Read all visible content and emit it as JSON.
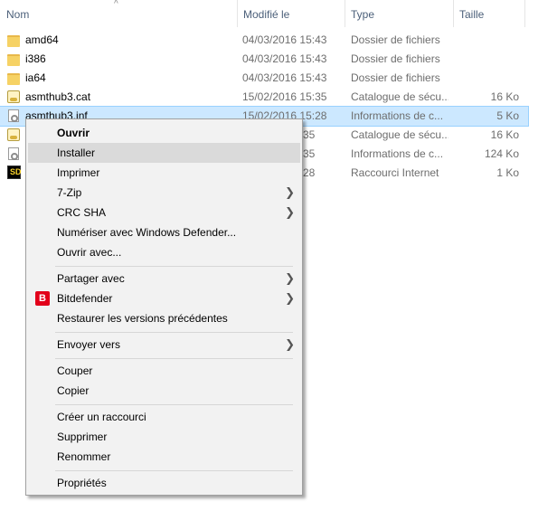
{
  "header": {
    "col_name": "Nom",
    "col_date": "Modifié le",
    "col_type": "Type",
    "col_size": "Taille"
  },
  "files": [
    {
      "name": "amd64",
      "date": "04/03/2016 15:43",
      "type": "Dossier de fichiers",
      "size": "",
      "icon": "folder-icon"
    },
    {
      "name": "i386",
      "date": "04/03/2016 15:43",
      "type": "Dossier de fichiers",
      "size": "",
      "icon": "folder-icon"
    },
    {
      "name": "ia64",
      "date": "04/03/2016 15:43",
      "type": "Dossier de fichiers",
      "size": "",
      "icon": "folder-icon"
    },
    {
      "name": "asmthub3.cat",
      "date": "15/02/2016 15:35",
      "type": "Catalogue de sécu...",
      "size": "16 Ko",
      "icon": "security-catalog-icon"
    },
    {
      "name": "asmthub3.inf",
      "date": "15/02/2016 15:28",
      "type": "Informations de c...",
      "size": "5 Ko",
      "icon": "setup-info-icon"
    },
    {
      "name": "",
      "date": "35",
      "type": "Catalogue de sécu...",
      "size": "16 Ko",
      "icon": "security-catalog-icon"
    },
    {
      "name": "",
      "date": "35",
      "type": "Informations de c...",
      "size": "124 Ko",
      "icon": "setup-info-icon"
    },
    {
      "name": "",
      "date": "28",
      "type": "Raccourci Internet",
      "size": "1 Ko",
      "icon": "internet-shortcut-icon"
    }
  ],
  "context_menu": {
    "open": "Ouvrir",
    "install": "Installer",
    "print": "Imprimer",
    "zip": "7-Zip",
    "crc": "CRC SHA",
    "defender": "Numériser avec Windows Defender...",
    "open_with": "Ouvrir avec...",
    "share": "Partager avec",
    "bitdefender": "Bitdefender",
    "bitdefender_glyph": "B",
    "restore": "Restaurer les versions précédentes",
    "send_to": "Envoyer vers",
    "cut": "Couper",
    "copy": "Copier",
    "shortcut": "Créer un raccourci",
    "delete": "Supprimer",
    "rename": "Renommer",
    "properties": "Propriétés"
  },
  "colors": {
    "selection": "#cce8ff",
    "header_text": "#4c607a",
    "menu_background": "#f2f2f2",
    "menu_hover": "#dadada",
    "bitdefender_red": "#e2001a"
  }
}
